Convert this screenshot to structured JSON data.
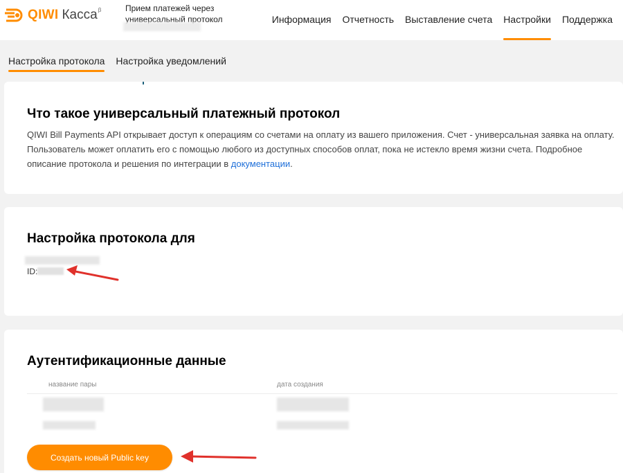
{
  "colors": {
    "accent": "#ff8c00",
    "link": "#1e6fd9",
    "arrow": "#e0312b"
  },
  "header": {
    "logo_brand": "QIWI",
    "logo_product": "Касса",
    "logo_badge": "β",
    "merchant_title": "Прием платежей через универсальный протокол",
    "nav": [
      "Информация",
      "Отчетность",
      "Выставление счета",
      "Настройки",
      "Поддержка"
    ],
    "active_nav": "Настройки"
  },
  "subtabs": {
    "items": [
      "Настройка протокола",
      "Настройка уведомлений"
    ],
    "active": "Настройка протокола"
  },
  "about": {
    "title": "Что такое универсальный платежный протокол",
    "description_1": "QIWI Bill Payments API открывает доступ к операциям со счетами на оплату из вашего приложения. Счет - универсальная заявка на оплату. Пользователь может оплатить его с помощью любого из доступных способов оплат, пока не истекло время жизни счета. Подробное описание протокола и решения по интеграции в ",
    "link_text": "документации",
    "description_end": "."
  },
  "protocol": {
    "title": "Настройка протокола для",
    "id_label": "ID:"
  },
  "auth": {
    "title": "Аутентификационные данные",
    "columns": [
      "название пары",
      "дата создания"
    ],
    "create_button": "Создать новый Public key"
  },
  "icons": [
    "qiwi-logo-icon",
    "red-arrow-icon"
  ]
}
